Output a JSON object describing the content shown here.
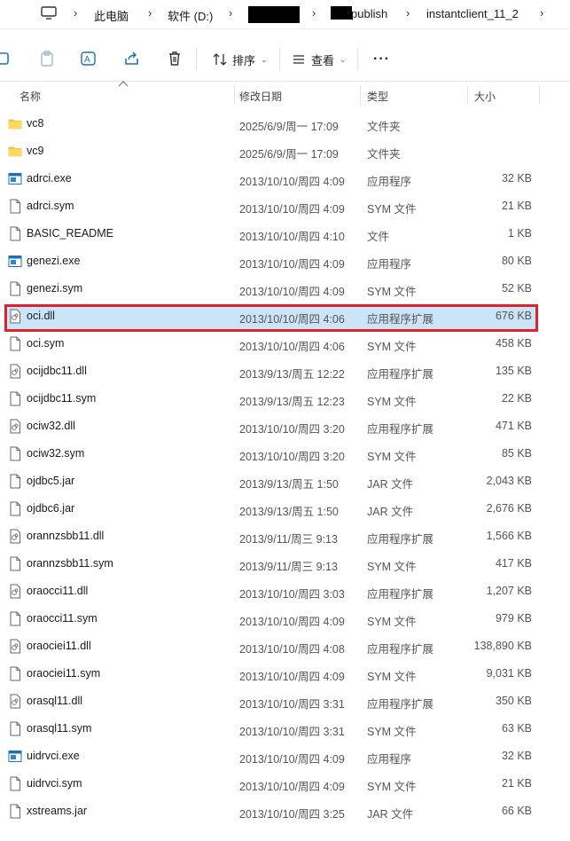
{
  "address": {
    "root": "此电脑",
    "drive": "软件 (D:)",
    "folder_publish": "publish",
    "folder_current": "instantclient_11_2"
  },
  "toolbar": {
    "sort_label": "排序",
    "view_label": "查看",
    "more_label": "···"
  },
  "columns": {
    "name": "名称",
    "modified": "修改日期",
    "type": "类型",
    "size": "大小"
  },
  "files": [
    {
      "name": "vc8",
      "modified": "2025/6/9/周一 17:09",
      "type": "文件夹",
      "size": "",
      "icon": "folder-icon"
    },
    {
      "name": "vc9",
      "modified": "2025/6/9/周一 17:09",
      "type": "文件夹",
      "size": "",
      "icon": "folder-icon"
    },
    {
      "name": "adrci.exe",
      "modified": "2013/10/10/周四 4:09",
      "type": "应用程序",
      "size": "32 KB",
      "icon": "exe-icon"
    },
    {
      "name": "adrci.sym",
      "modified": "2013/10/10/周四 4:09",
      "type": "SYM 文件",
      "size": "21 KB",
      "icon": "file-icon"
    },
    {
      "name": "BASIC_README",
      "modified": "2013/10/10/周四 4:10",
      "type": "文件",
      "size": "1 KB",
      "icon": "file-icon"
    },
    {
      "name": "genezi.exe",
      "modified": "2013/10/10/周四 4:09",
      "type": "应用程序",
      "size": "80 KB",
      "icon": "exe-icon"
    },
    {
      "name": "genezi.sym",
      "modified": "2013/10/10/周四 4:09",
      "type": "SYM 文件",
      "size": "52 KB",
      "icon": "file-icon"
    },
    {
      "name": "oci.dll",
      "modified": "2013/10/10/周四 4:06",
      "type": "应用程序扩展",
      "size": "676 KB",
      "icon": "dll-icon",
      "selected": true
    },
    {
      "name": "oci.sym",
      "modified": "2013/10/10/周四 4:06",
      "type": "SYM 文件",
      "size": "458 KB",
      "icon": "file-icon"
    },
    {
      "name": "ocijdbc11.dll",
      "modified": "2013/9/13/周五 12:22",
      "type": "应用程序扩展",
      "size": "135 KB",
      "icon": "dll-icon"
    },
    {
      "name": "ocijdbc11.sym",
      "modified": "2013/9/13/周五 12:23",
      "type": "SYM 文件",
      "size": "22 KB",
      "icon": "file-icon"
    },
    {
      "name": "ociw32.dll",
      "modified": "2013/10/10/周四 3:20",
      "type": "应用程序扩展",
      "size": "471 KB",
      "icon": "dll-icon"
    },
    {
      "name": "ociw32.sym",
      "modified": "2013/10/10/周四 3:20",
      "type": "SYM 文件",
      "size": "85 KB",
      "icon": "file-icon"
    },
    {
      "name": "ojdbc5.jar",
      "modified": "2013/9/13/周五 1:50",
      "type": "JAR 文件",
      "size": "2,043 KB",
      "icon": "file-icon"
    },
    {
      "name": "ojdbc6.jar",
      "modified": "2013/9/13/周五 1:50",
      "type": "JAR 文件",
      "size": "2,676 KB",
      "icon": "file-icon"
    },
    {
      "name": "orannzsbb11.dll",
      "modified": "2013/9/11/周三 9:13",
      "type": "应用程序扩展",
      "size": "1,566 KB",
      "icon": "dll-icon"
    },
    {
      "name": "orannzsbb11.sym",
      "modified": "2013/9/11/周三 9:13",
      "type": "SYM 文件",
      "size": "417 KB",
      "icon": "file-icon"
    },
    {
      "name": "oraocci11.dll",
      "modified": "2013/10/10/周四 3:03",
      "type": "应用程序扩展",
      "size": "1,207 KB",
      "icon": "dll-icon"
    },
    {
      "name": "oraocci11.sym",
      "modified": "2013/10/10/周四 4:09",
      "type": "SYM 文件",
      "size": "979 KB",
      "icon": "file-icon"
    },
    {
      "name": "oraociei11.dll",
      "modified": "2013/10/10/周四 4:08",
      "type": "应用程序扩展",
      "size": "138,890 KB",
      "icon": "dll-icon"
    },
    {
      "name": "oraociei11.sym",
      "modified": "2013/10/10/周四 4:09",
      "type": "SYM 文件",
      "size": "9,031 KB",
      "icon": "file-icon"
    },
    {
      "name": "orasql11.dll",
      "modified": "2013/10/10/周四 3:31",
      "type": "应用程序扩展",
      "size": "350 KB",
      "icon": "dll-icon"
    },
    {
      "name": "orasql11.sym",
      "modified": "2013/10/10/周四 3:31",
      "type": "SYM 文件",
      "size": "63 KB",
      "icon": "file-icon"
    },
    {
      "name": "uidrvci.exe",
      "modified": "2013/10/10/周四 4:09",
      "type": "应用程序",
      "size": "32 KB",
      "icon": "exe-icon"
    },
    {
      "name": "uidrvci.sym",
      "modified": "2013/10/10/周四 4:09",
      "type": "SYM 文件",
      "size": "21 KB",
      "icon": "file-icon"
    },
    {
      "name": "xstreams.jar",
      "modified": "2013/10/10/周四 3:25",
      "type": "JAR 文件",
      "size": "66 KB",
      "icon": "file-icon"
    }
  ],
  "colors": {
    "selection": "#cce4f7",
    "highlight_border": "#e0202d",
    "folder": "#f5c542",
    "exe": "#1f6fb2"
  }
}
